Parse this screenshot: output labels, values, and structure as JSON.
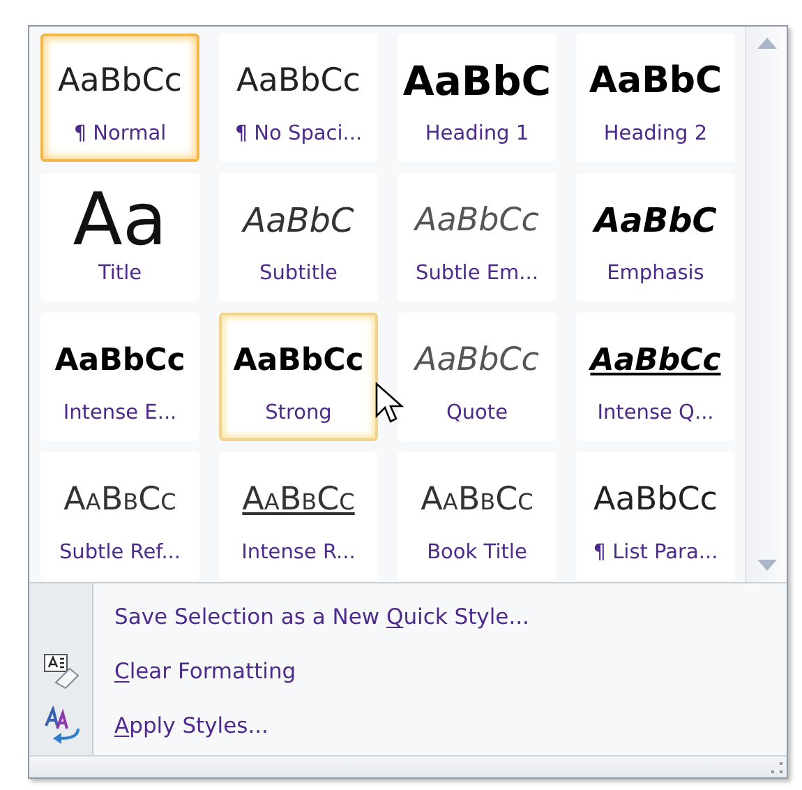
{
  "gallery": {
    "styles": [
      {
        "name": "¶ Normal",
        "preview": "AaBbCc",
        "kind": "normal",
        "selected": true,
        "hovered": false
      },
      {
        "name": "¶ No Spaci...",
        "preview": "AaBbCc",
        "kind": "normal",
        "selected": false,
        "hovered": false
      },
      {
        "name": "Heading 1",
        "preview": "AaBbC",
        "kind": "heading1",
        "selected": false,
        "hovered": false
      },
      {
        "name": "Heading 2",
        "preview": "AaBbC",
        "kind": "heading2",
        "selected": false,
        "hovered": false
      },
      {
        "name": "Title",
        "preview": "Aa",
        "kind": "title",
        "selected": false,
        "hovered": false
      },
      {
        "name": "Subtitle",
        "preview": "AaBbC",
        "kind": "subtitle",
        "selected": false,
        "hovered": false
      },
      {
        "name": "Subtle Em...",
        "preview": "AaBbCc",
        "kind": "subtle",
        "selected": false,
        "hovered": false
      },
      {
        "name": "Emphasis",
        "preview": "AaBbC",
        "kind": "emphasis",
        "selected": false,
        "hovered": false
      },
      {
        "name": "Intense E...",
        "preview": "AaBbCc",
        "kind": "strong",
        "selected": false,
        "hovered": false
      },
      {
        "name": "Strong",
        "preview": "AaBbCc",
        "kind": "strong",
        "selected": false,
        "hovered": true
      },
      {
        "name": "Quote",
        "preview": "AaBbCc",
        "kind": "subtle",
        "selected": false,
        "hovered": false
      },
      {
        "name": "Intense Q...",
        "preview": "AaBbCc",
        "kind": "intense-quote",
        "selected": false,
        "hovered": false
      },
      {
        "name": "Subtle Ref...",
        "preview": "AaBbCc",
        "kind": "smallcaps",
        "selected": false,
        "hovered": false
      },
      {
        "name": "Intense R...",
        "preview": "AaBbCc",
        "kind": "smallcaps-underline",
        "selected": false,
        "hovered": false
      },
      {
        "name": "Book Title",
        "preview": "AaBbCc",
        "kind": "smallcaps",
        "selected": false,
        "hovered": false
      },
      {
        "name": "¶ List Para...",
        "preview": "AaBbCc",
        "kind": "normal",
        "selected": false,
        "hovered": false
      }
    ]
  },
  "menu": [
    {
      "before": "Save Selection as a New ",
      "access_key": "Q",
      "after": "uick Style...",
      "kind": "plain"
    },
    {
      "access_key": "C",
      "after": "lear Formatting",
      "kind": "eraser"
    },
    {
      "access_key": "A",
      "after": "pply Styles...",
      "kind": "apply"
    }
  ]
}
